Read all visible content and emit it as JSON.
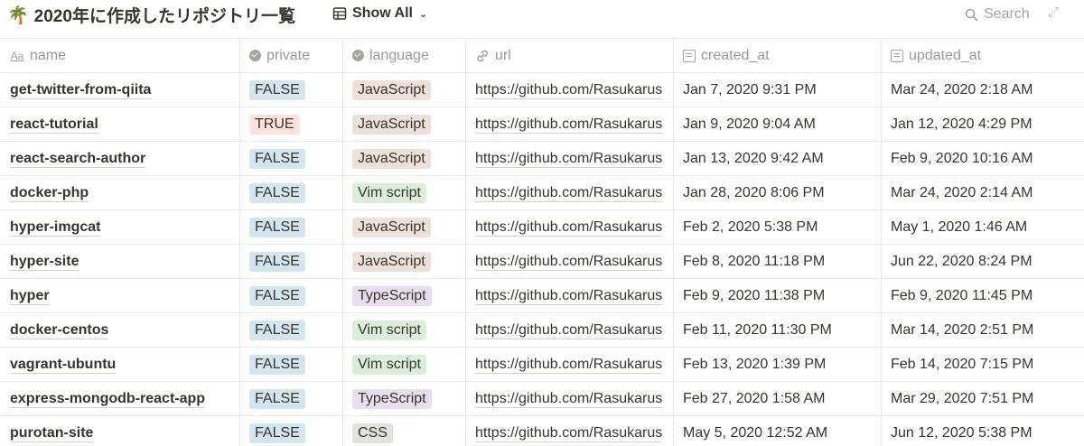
{
  "header": {
    "emoji": "🌴",
    "title": "2020年に作成したリポジトリ一覧",
    "view_label": "Show All",
    "search_label": "Search"
  },
  "columns": {
    "name": "name",
    "private": "private",
    "language": "language",
    "url": "url",
    "created_at": "created_at",
    "updated_at": "updated_at"
  },
  "colors": {
    "FALSE": "#d3e5ef",
    "TRUE": "#ffe2dd",
    "JavaScript": "#eee0da",
    "Vim script": "#dbeddb",
    "TypeScript": "#e8deee",
    "CSS": "#e3e2e0"
  },
  "rows": [
    {
      "name": "get-twitter-from-qiita",
      "private": "FALSE",
      "language": "JavaScript",
      "url": "https://github.com/Rasukarus",
      "created_at": "Jan 7, 2020 9:31 PM",
      "updated_at": "Mar 24, 2020 2:18 AM"
    },
    {
      "name": "react-tutorial",
      "private": "TRUE",
      "language": "JavaScript",
      "url": "https://github.com/Rasukarus",
      "created_at": "Jan 9, 2020 9:04 AM",
      "updated_at": "Jan 12, 2020 4:29 PM"
    },
    {
      "name": "react-search-author",
      "private": "FALSE",
      "language": "JavaScript",
      "url": "https://github.com/Rasukarus",
      "created_at": "Jan 13, 2020 9:42 AM",
      "updated_at": "Feb 9, 2020 10:16 AM"
    },
    {
      "name": "docker-php",
      "private": "FALSE",
      "language": "Vim script",
      "url": "https://github.com/Rasukarus",
      "created_at": "Jan 28, 2020 8:06 PM",
      "updated_at": "Mar 24, 2020 2:14 AM"
    },
    {
      "name": "hyper-imgcat",
      "private": "FALSE",
      "language": "JavaScript",
      "url": "https://github.com/Rasukarus",
      "created_at": "Feb 2, 2020 5:38 PM",
      "updated_at": "May 1, 2020 1:46 AM"
    },
    {
      "name": "hyper-site",
      "private": "FALSE",
      "language": "JavaScript",
      "url": "https://github.com/Rasukarus",
      "created_at": "Feb 8, 2020 11:18 PM",
      "updated_at": "Jun 22, 2020 8:24 PM"
    },
    {
      "name": "hyper",
      "private": "FALSE",
      "language": "TypeScript",
      "url": "https://github.com/Rasukarus",
      "created_at": "Feb 9, 2020 11:38 PM",
      "updated_at": "Feb 9, 2020 11:45 PM"
    },
    {
      "name": "docker-centos",
      "private": "FALSE",
      "language": "Vim script",
      "url": "https://github.com/Rasukarus",
      "created_at": "Feb 11, 2020 11:30 PM",
      "updated_at": "Mar 14, 2020 2:51 PM"
    },
    {
      "name": "vagrant-ubuntu",
      "private": "FALSE",
      "language": "Vim script",
      "url": "https://github.com/Rasukarus",
      "created_at": "Feb 13, 2020 1:39 PM",
      "updated_at": "Feb 14, 2020 7:15 PM"
    },
    {
      "name": "express-mongodb-react-app",
      "private": "FALSE",
      "language": "TypeScript",
      "url": "https://github.com/Rasukarus",
      "created_at": "Feb 27, 2020 1:58 AM",
      "updated_at": "Mar 29, 2020 7:51 PM"
    },
    {
      "name": "purotan-site",
      "private": "FALSE",
      "language": "CSS",
      "url": "https://github.com/Rasukarus",
      "created_at": "May 5, 2020 12:52 AM",
      "updated_at": "Jun 12, 2020 5:38 PM"
    }
  ]
}
